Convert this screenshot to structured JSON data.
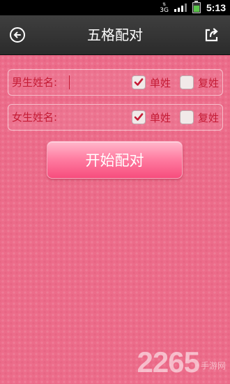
{
  "status_bar": {
    "network": "3G",
    "time": "5:13"
  },
  "header": {
    "title": "五格配对",
    "back_icon": "back-arrow-circle-icon",
    "share_icon": "share-export-icon"
  },
  "form": {
    "male": {
      "label": "男生姓名:",
      "value": "",
      "single_label": "单姓",
      "single_checked": true,
      "double_label": "复姓",
      "double_checked": false
    },
    "female": {
      "label": "女生姓名:",
      "value": "",
      "single_label": "单姓",
      "single_checked": true,
      "double_label": "复姓",
      "double_checked": false
    }
  },
  "start_button": "开始配对",
  "watermark": {
    "number": "2265",
    "text": "手游网"
  },
  "colors": {
    "background": "#ec6c8a",
    "label": "#c41b35",
    "header": "#333333"
  }
}
